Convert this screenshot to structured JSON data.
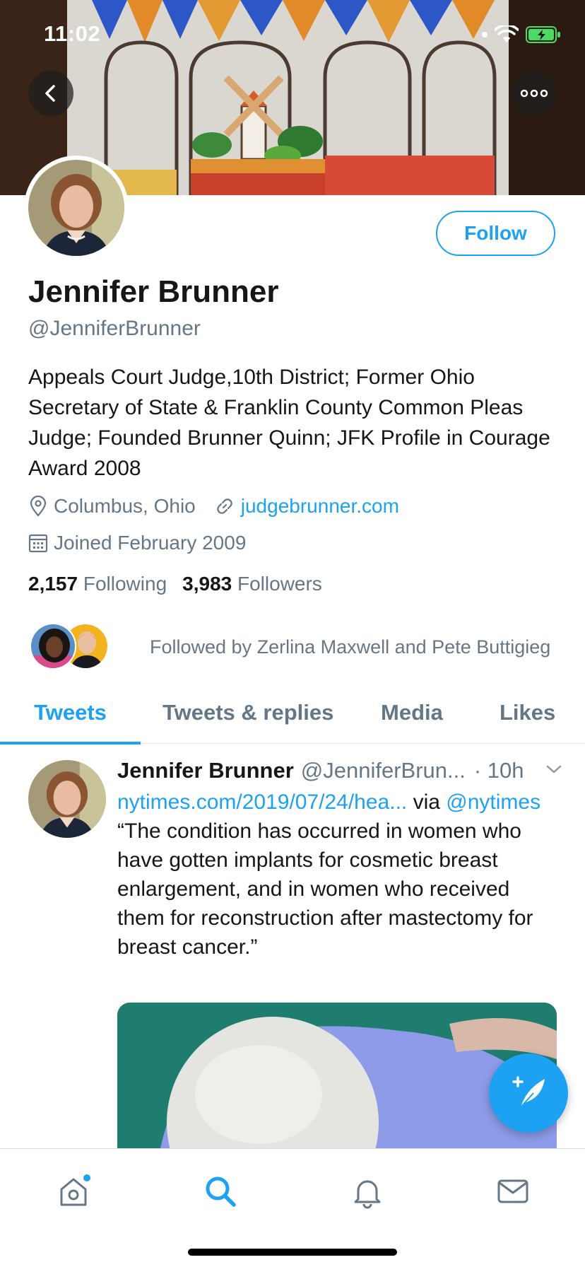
{
  "status": {
    "time": "11:02"
  },
  "profile": {
    "name": "Jennifer Brunner",
    "handle": "@JenniferBrunner",
    "bio": "Appeals Court Judge,10th District; Former Ohio Secretary of State & Franklin County Common Pleas Judge; Founded Brunner Quinn; JFK Profile in Courage Award 2008",
    "location": "Columbus, Ohio",
    "website": "judgebrunner.com",
    "joined": "Joined February 2009",
    "following_count": "2,157",
    "following_label": "Following",
    "followers_count": "3,983",
    "followers_label": "Followers",
    "followed_by": "Followed by Zerlina Maxwell and Pete Buttigieg"
  },
  "actions": {
    "follow_label": "Follow"
  },
  "tabs": [
    {
      "label": "Tweets",
      "active": true
    },
    {
      "label": "Tweets & replies",
      "active": false
    },
    {
      "label": "Media",
      "active": false
    },
    {
      "label": "Likes",
      "active": false
    }
  ],
  "tweet": {
    "author_name": "Jennifer Brunner",
    "author_handle": "@JenniferBrun...",
    "time": "· 10h",
    "link": "nytimes.com/2019/07/24/hea...",
    "via": " via",
    "mention": "@nytimes",
    "text": " “The condition has occurred in women who have gotten implants for cosmetic breast enlargement, and in women who received them for reconstruction after mastectomy for breast cancer.”"
  },
  "icons": {
    "back": "chevron-left-icon",
    "more": "more-horizontal-icon",
    "location": "location-pin-icon",
    "link": "link-icon",
    "calendar": "calendar-icon",
    "caret": "chevron-down-icon",
    "compose": "compose-tweet-icon",
    "home": "home-icon",
    "search": "search-icon",
    "notifications": "bell-icon",
    "messages": "mail-icon"
  },
  "colors": {
    "accent": "#1da1f2",
    "text_primary": "#14171a",
    "text_secondary": "#657786",
    "battery": "#4cd964"
  }
}
